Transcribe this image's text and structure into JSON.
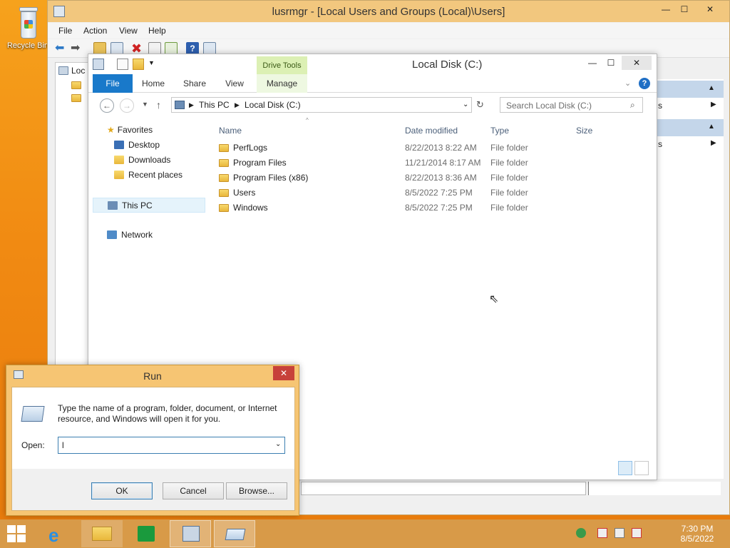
{
  "desktop": {
    "recycle_bin_label": "Recycle Bin"
  },
  "lusrmgr": {
    "title": "lusrmgr - [Local Users and Groups (Local)\\Users]",
    "menu": [
      "File",
      "Action",
      "View",
      "Help"
    ],
    "tree_label": "Loc",
    "actions_items": [
      "s",
      "s"
    ]
  },
  "explorer": {
    "title": "Local Disk (C:)",
    "drive_tools": "Drive Tools",
    "tabs": [
      "File",
      "Home",
      "Share",
      "View",
      "Manage"
    ],
    "address": [
      "This PC",
      "Local Disk (C:)"
    ],
    "search_placeholder": "Search Local Disk (C:)",
    "nav": {
      "favorites": "Favorites",
      "favorites_items": [
        "Desktop",
        "Downloads",
        "Recent places"
      ],
      "this_pc": "This PC",
      "network": "Network"
    },
    "columns": [
      "Name",
      "Date modified",
      "Type",
      "Size"
    ],
    "rows": [
      {
        "name": "PerfLogs",
        "date": "8/22/2013 8:22 AM",
        "type": "File folder"
      },
      {
        "name": "Program Files",
        "date": "11/21/2014 8:17 AM",
        "type": "File folder"
      },
      {
        "name": "Program Files (x86)",
        "date": "8/22/2013 8:36 AM",
        "type": "File folder"
      },
      {
        "name": "Users",
        "date": "8/5/2022 7:25 PM",
        "type": "File folder"
      },
      {
        "name": "Windows",
        "date": "8/5/2022 7:25 PM",
        "type": "File folder"
      }
    ]
  },
  "run": {
    "title": "Run",
    "description_line1": "Type the name of a program, folder, document, or Internet",
    "description_line2": "resource, and Windows will open it for you.",
    "open_label": "Open:",
    "open_value": "l",
    "ok": "OK",
    "cancel": "Cancel",
    "browse": "Browse..."
  },
  "taskbar": {
    "time": "7:30 PM",
    "date": "8/5/2022"
  },
  "colors": {
    "accent": "#1979ca",
    "titlebar": "#f2c77e",
    "run_frame": "#f6c573",
    "close": "#c7413a"
  }
}
